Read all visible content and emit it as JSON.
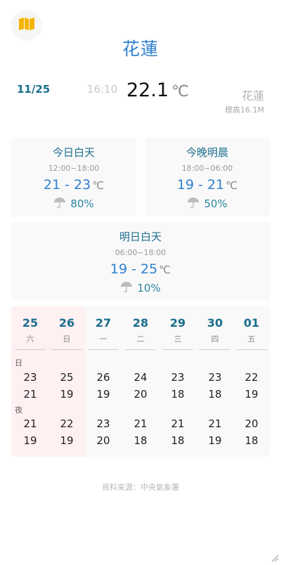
{
  "header": {
    "location_title": "花蓮"
  },
  "current": {
    "date": "11/25",
    "time": "16:10",
    "temp": "22.1",
    "unit": "℃",
    "station": "花蓮",
    "altitude": "標高16.1M"
  },
  "cards": [
    {
      "title": "今日白天",
      "range": "12:00~18:00",
      "temp": "21 - 23",
      "unit": "℃",
      "rain": "80%"
    },
    {
      "title": "今晚明晨",
      "range": "18:00~06:00",
      "temp": "19 - 21",
      "unit": "℃",
      "rain": "50%"
    },
    {
      "title": "明日白天",
      "range": "06:00~18:00",
      "temp": "19 - 25",
      "unit": "℃",
      "rain": "10%"
    }
  ],
  "week": {
    "day_label": "日",
    "night_label": "夜",
    "days": [
      {
        "date": "25",
        "weekday": "六",
        "day_hi": "23",
        "day_lo": "21",
        "night_hi": "21",
        "night_lo": "19"
      },
      {
        "date": "26",
        "weekday": "日",
        "day_hi": "25",
        "day_lo": "19",
        "night_hi": "22",
        "night_lo": "19"
      },
      {
        "date": "27",
        "weekday": "一",
        "day_hi": "26",
        "day_lo": "19",
        "night_hi": "23",
        "night_lo": "20"
      },
      {
        "date": "28",
        "weekday": "二",
        "day_hi": "24",
        "day_lo": "20",
        "night_hi": "21",
        "night_lo": "18"
      },
      {
        "date": "29",
        "weekday": "三",
        "day_hi": "23",
        "day_lo": "18",
        "night_hi": "21",
        "night_lo": "18"
      },
      {
        "date": "30",
        "weekday": "四",
        "day_hi": "23",
        "day_lo": "18",
        "night_hi": "21",
        "night_lo": "19"
      },
      {
        "date": "01",
        "weekday": "五",
        "day_hi": "22",
        "day_lo": "19",
        "night_hi": "20",
        "night_lo": "18"
      }
    ]
  },
  "footer": {
    "source": "資料來源：中央氣象署"
  },
  "colors": {
    "accent": "#2f7fd0",
    "teal": "#1a6e8c",
    "map_icon": "#f5b400",
    "weekend_bg": "#fff0f2"
  },
  "icons": {
    "map": "map-icon",
    "umbrella": "umbrella-icon"
  }
}
